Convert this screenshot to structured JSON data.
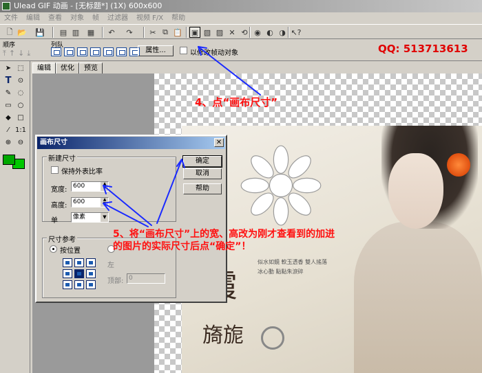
{
  "window": {
    "title": "Ulead GIF 动画 - [无标题*] (1X) 600x600"
  },
  "menu": [
    "文件",
    "编辑",
    "查看",
    "对象",
    "帧",
    "过滤器",
    "视频 F/X",
    "帮助"
  ],
  "toolbar": {
    "active_tool": "画布尺寸"
  },
  "toolbar2": {
    "order_label": "顺序",
    "queue_label": "列队",
    "attributes_button": "属性...",
    "sync_label": "以修改帧动对象"
  },
  "qq": "QQ: 513713613",
  "tabs": [
    {
      "label": "编辑",
      "active": true
    },
    {
      "label": "优化",
      "active": false
    },
    {
      "label": "预览",
      "active": false
    }
  ],
  "dialog": {
    "title": "画布尺寸",
    "new_size_group": "新建尺寸",
    "keep_ratio_label": "保持外表比率",
    "width_label": "宽度:",
    "width_value": "600",
    "height_label": "高度:",
    "height_value": "600",
    "unit_label": "单",
    "unit_value": "像素",
    "reference_group": "尺寸参考",
    "by_position_label": "按位置",
    "other_radio_label": "",
    "ok_button": "确定",
    "cancel_button": "取消",
    "help_button": "帮助",
    "disabled_left_label": "左",
    "disabled_top_label": "顶部:",
    "disabled_top_value": "0"
  },
  "photo": {
    "poem_line1": "似水如鏡 軟玉透香 雙人搖落",
    "poem_line2": "冰心動 點點朱淚碎",
    "calligraphy1": "霞",
    "calligraphy2": "旖旎"
  },
  "annotations": {
    "step4": "4、点“画布尺寸”",
    "step5": "5、将“画布尺寸”上的宽、高改为刚才查看到的加进的图片的实际尺寸后点“确定”！"
  },
  "colors": {
    "annotation": "#ff1010",
    "qq": "#e00000",
    "arrow": "#1a2aff"
  }
}
